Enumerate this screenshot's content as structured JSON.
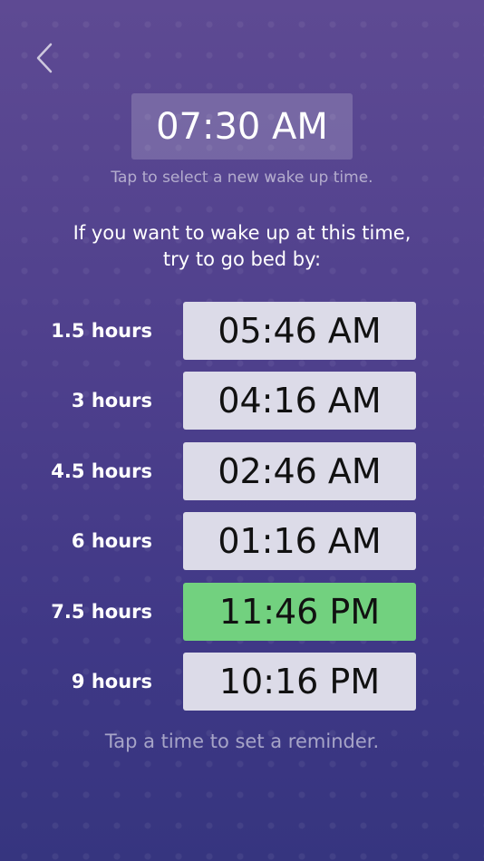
{
  "nav": {
    "back_icon": "chevron-left-icon"
  },
  "wake_time": "07:30 AM",
  "wake_hint": "Tap to select a new wake up time.",
  "instruction": {
    "line1": "If you want to wake up at this time,",
    "line2": "try to go bed by:"
  },
  "options": [
    {
      "duration": "1.5 hours",
      "time": "05:46 AM"
    },
    {
      "duration": "3 hours",
      "time": "04:16 AM"
    },
    {
      "duration": "4.5 hours",
      "time": "02:46 AM"
    },
    {
      "duration": "6 hours",
      "time": "01:16 AM"
    },
    {
      "duration": "7.5 hours",
      "time": "11:46 PM",
      "recommended": true
    },
    {
      "duration": "9 hours",
      "time": "10:16 PM"
    }
  ],
  "reminder_hint": "Tap a time to set a reminder.",
  "colors": {
    "background_top": "#5e4a93",
    "background_bottom": "#36357f",
    "time_button": "#dcdbe8",
    "recommended": "#72d17f"
  }
}
